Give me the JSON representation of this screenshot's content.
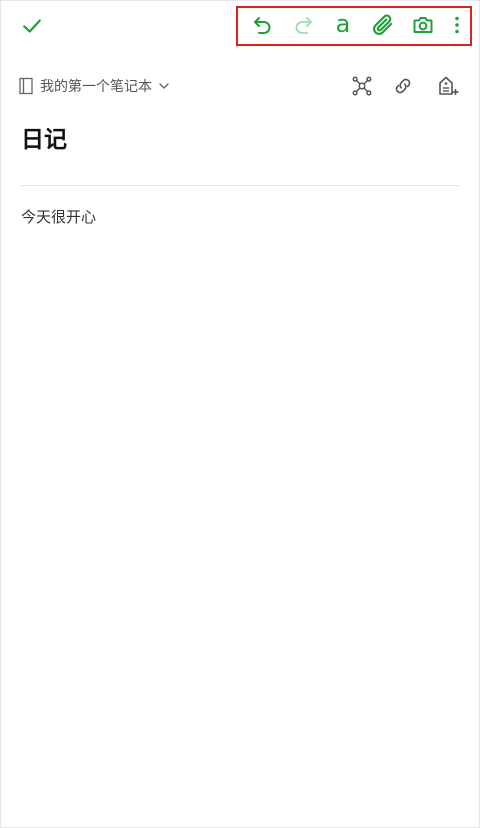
{
  "toolbar": {
    "done_icon": "check-icon",
    "undo_icon": "undo-icon",
    "redo_icon": "redo-icon",
    "format_label": "a",
    "attach_icon": "paperclip-icon",
    "camera_icon": "camera-icon",
    "more_icon": "more-vertical-icon"
  },
  "colors": {
    "accent": "#1fa038",
    "accent_disabled": "#a6dfb3",
    "highlight": "#e01f1f",
    "muted": "#555555"
  },
  "notebook": {
    "name": "我的第一个笔记本",
    "icon": "notebook-icon"
  },
  "note": {
    "title": "日记",
    "body": "今天很开心"
  }
}
